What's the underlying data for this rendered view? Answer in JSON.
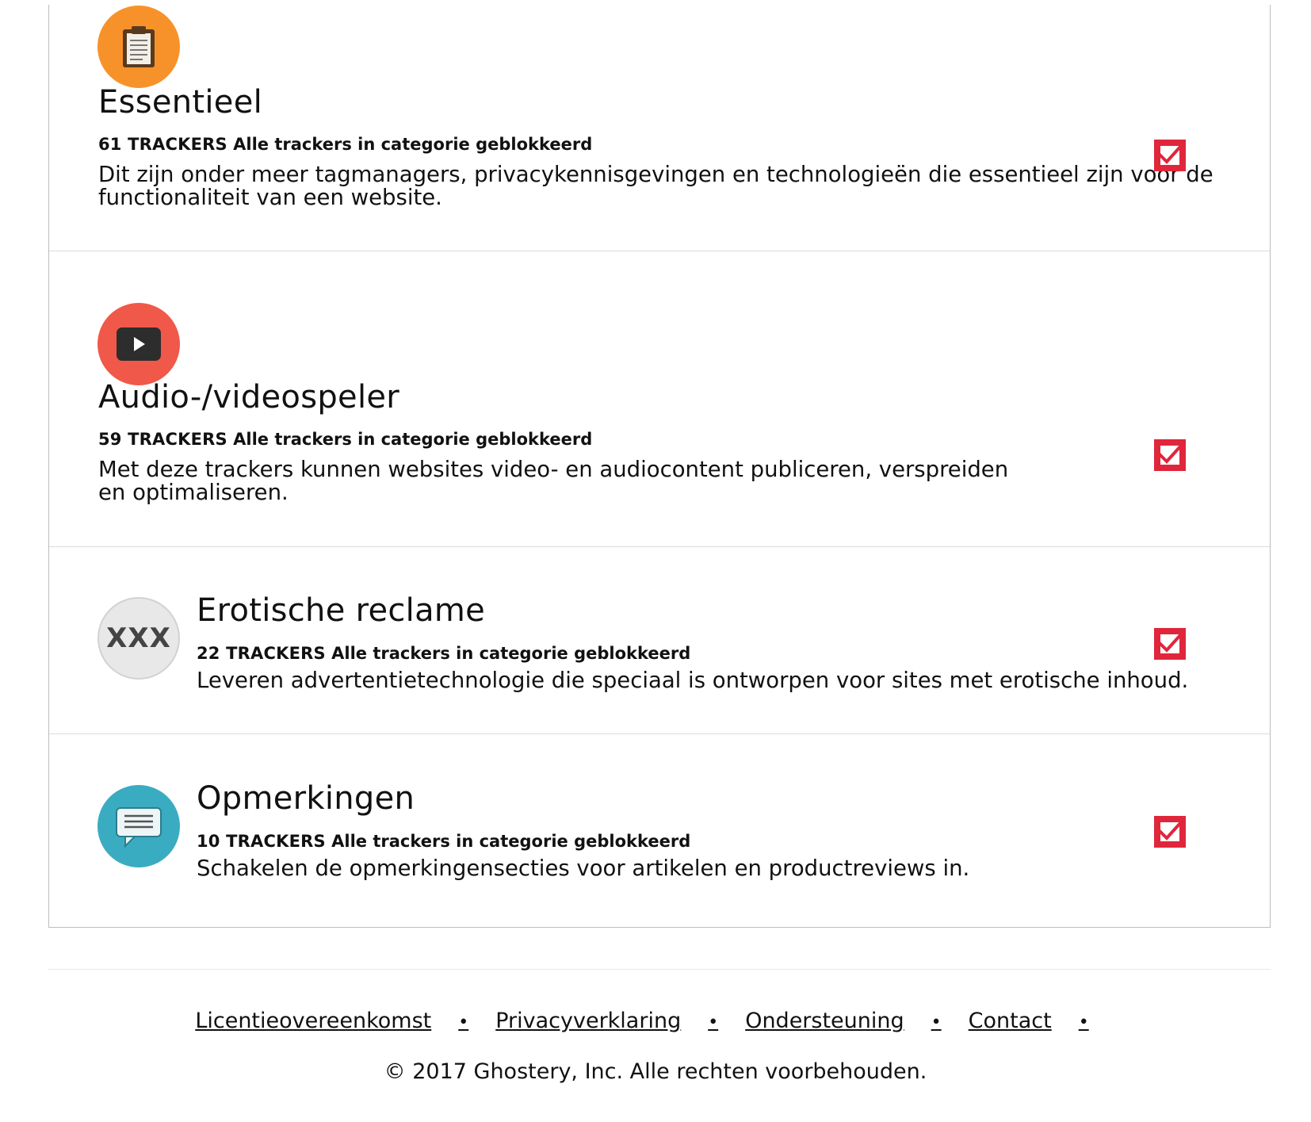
{
  "categories": [
    {
      "title": "Essentieel",
      "count": "61 TRACKERS",
      "status": "Alle trackers in categorie geblokkeerd",
      "description": "Dit zijn onder meer tagmanagers, privacykennisgevingen en technologieën die essentieel zijn voor de functionaliteit van een website.",
      "icon": "clipboard-icon",
      "icon_color": "#f7922a",
      "checked": true
    },
    {
      "title": "Audio-/videospeler",
      "count": "59 TRACKERS",
      "status": "Alle trackers in categorie geblokkeerd",
      "description": "Met deze trackers kunnen websites video- en audiocontent publiceren, verspreiden en optimaliseren.",
      "icon": "play-icon",
      "icon_color": "#f0584a",
      "checked": true
    },
    {
      "title": "Erotische reclame",
      "count": "22 TRACKERS",
      "status": "Alle trackers in categorie geblokkeerd",
      "description": "Leveren advertentietechnologie die speciaal is ontworpen voor sites met erotische inhoud.",
      "icon": "xxx-icon",
      "icon_text": "XXX",
      "icon_color": "#e8e8e8",
      "checked": true
    },
    {
      "title": "Opmerkingen",
      "count": "10 TRACKERS",
      "status": "Alle trackers in categorie geblokkeerd",
      "description": "Schakelen de opmerkingensecties voor artikelen en productreviews in.",
      "icon": "comment-icon",
      "icon_color": "#3aacc1",
      "checked": true
    }
  ],
  "footer": {
    "links": [
      "Licentieovereenkomst",
      "Privacyverklaring",
      "Ondersteuning",
      "Contact"
    ],
    "separator": "•",
    "copyright": "© 2017 Ghostery, Inc. Alle rechten voorbehouden."
  },
  "colors": {
    "checkbox": "#e0263b",
    "border": "#bdbdbd"
  }
}
